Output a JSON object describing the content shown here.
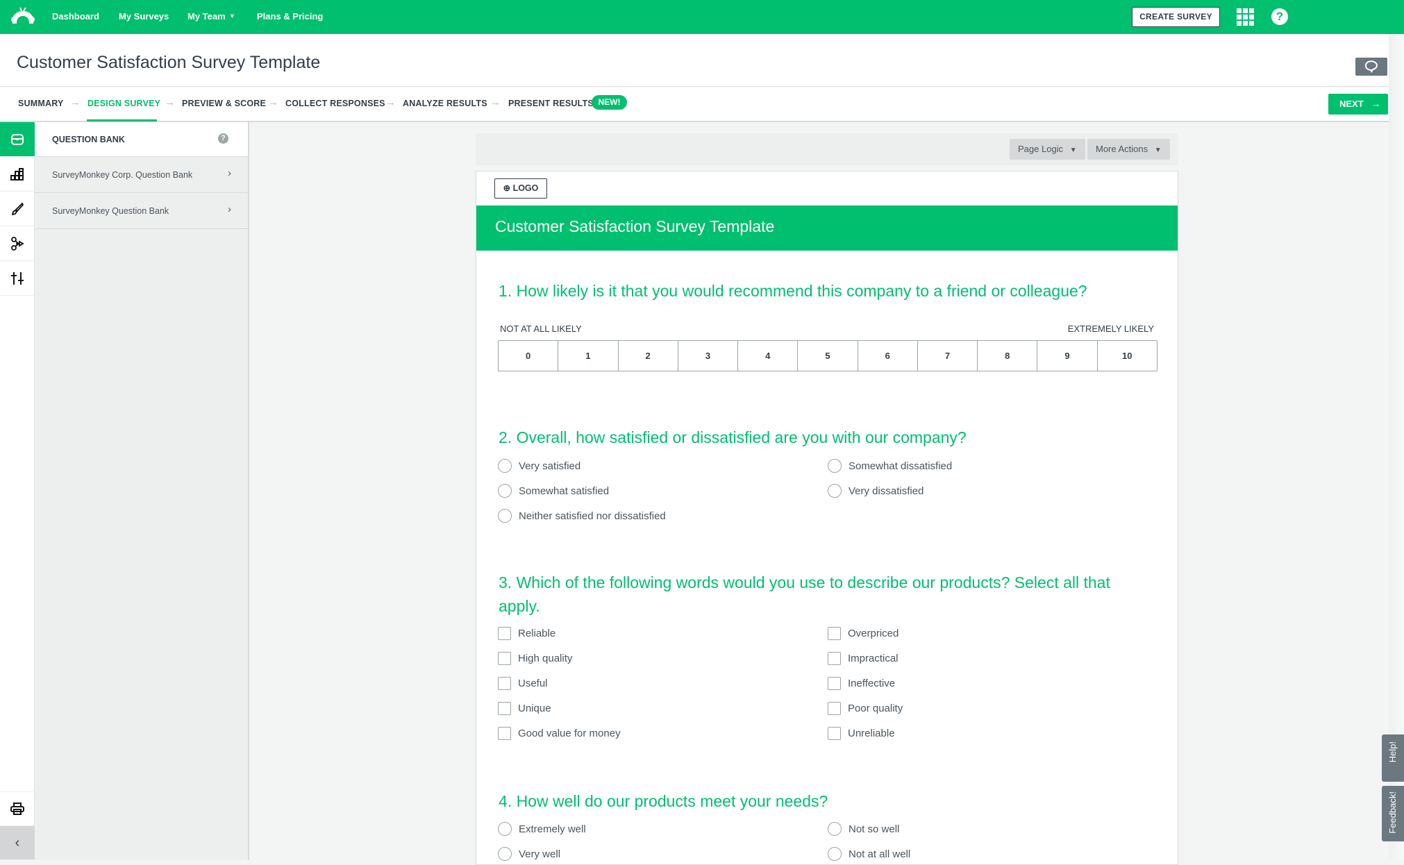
{
  "nav": {
    "links": [
      "Dashboard",
      "My Surveys",
      "My Team",
      "Plans & Pricing"
    ],
    "create_survey": "CREATE SURVEY"
  },
  "title": "Customer Satisfaction Survey Template",
  "steps": [
    "SUMMARY",
    "DESIGN SURVEY",
    "PREVIEW & SCORE",
    "COLLECT RESPONSES",
    "ANALYZE RESULTS",
    "PRESENT RESULTS"
  ],
  "active_step": "DESIGN SURVEY",
  "new_badge": "NEW!",
  "next": "NEXT",
  "question_bank": {
    "title": "QUESTION BANK",
    "items": [
      "SurveyMonkey Corp. Question Bank",
      "SurveyMonkey Question Bank"
    ]
  },
  "toolbar": {
    "page_logic": "Page Logic",
    "more_actions": "More Actions"
  },
  "survey": {
    "logo": "LOGO",
    "header": "Customer Satisfaction Survey Template",
    "q1": {
      "title": "1. How likely is it that you would recommend this company to a friend or colleague?",
      "low": "NOT AT ALL LIKELY",
      "high": "EXTREMELY LIKELY",
      "scale": [
        "0",
        "1",
        "2",
        "3",
        "4",
        "5",
        "6",
        "7",
        "8",
        "9",
        "10"
      ]
    },
    "q2": {
      "title": "2. Overall, how satisfied or dissatisfied are you with our company?",
      "options": [
        "Very satisfied",
        "Somewhat satisfied",
        "Neither satisfied nor dissatisfied",
        "Somewhat dissatisfied",
        "Very dissatisfied"
      ]
    },
    "q3": {
      "title": "3. Which of the following words would you use to describe our products? Select all that apply.",
      "options": [
        "Reliable",
        "High quality",
        "Useful",
        "Unique",
        "Good value for money",
        "Overpriced",
        "Impractical",
        "Ineffective",
        "Poor quality",
        "Unreliable"
      ]
    },
    "q4": {
      "title": "4. How well do our products meet your needs?",
      "options": [
        "Extremely well",
        "Very well",
        "Not so well",
        "Not at all well"
      ]
    }
  },
  "side_tabs": {
    "help": "Help!",
    "feedback": "Feedback!"
  },
  "colors": {
    "brand": "#00bf6f",
    "text": "#333e48"
  }
}
